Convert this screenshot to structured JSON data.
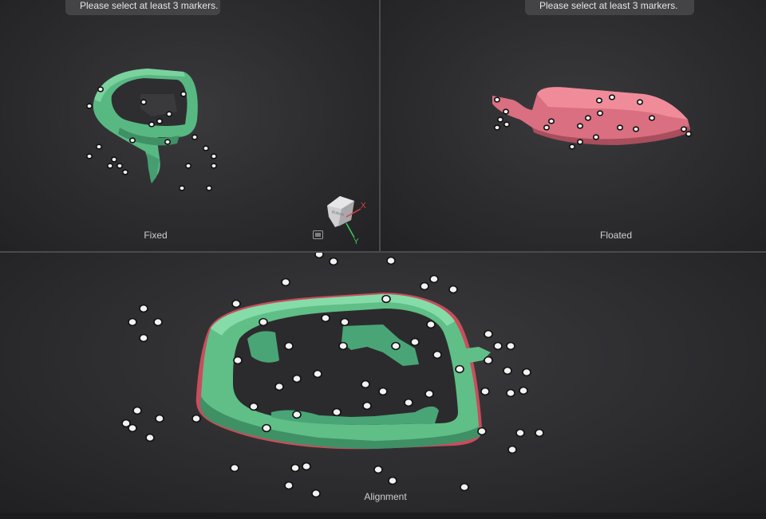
{
  "viewports": {
    "fixed": {
      "hint": "Please select at least 3 markers.",
      "label": "Fixed"
    },
    "floated": {
      "hint": "Please select at least 3 markers.",
      "label": "Floated"
    },
    "alignment": {
      "label": "Alignment"
    }
  },
  "view_cube": {
    "face_label": "Bottom",
    "x_axis": "X",
    "y_axis": "Y"
  },
  "colors": {
    "fixed_mesh": "#5fbf86",
    "floated_mesh": "#e07a88",
    "marker_fill": "#f2f2f2",
    "marker_ring": "#111111",
    "axis_x": "#e04040",
    "axis_y": "#3fcf5a"
  }
}
